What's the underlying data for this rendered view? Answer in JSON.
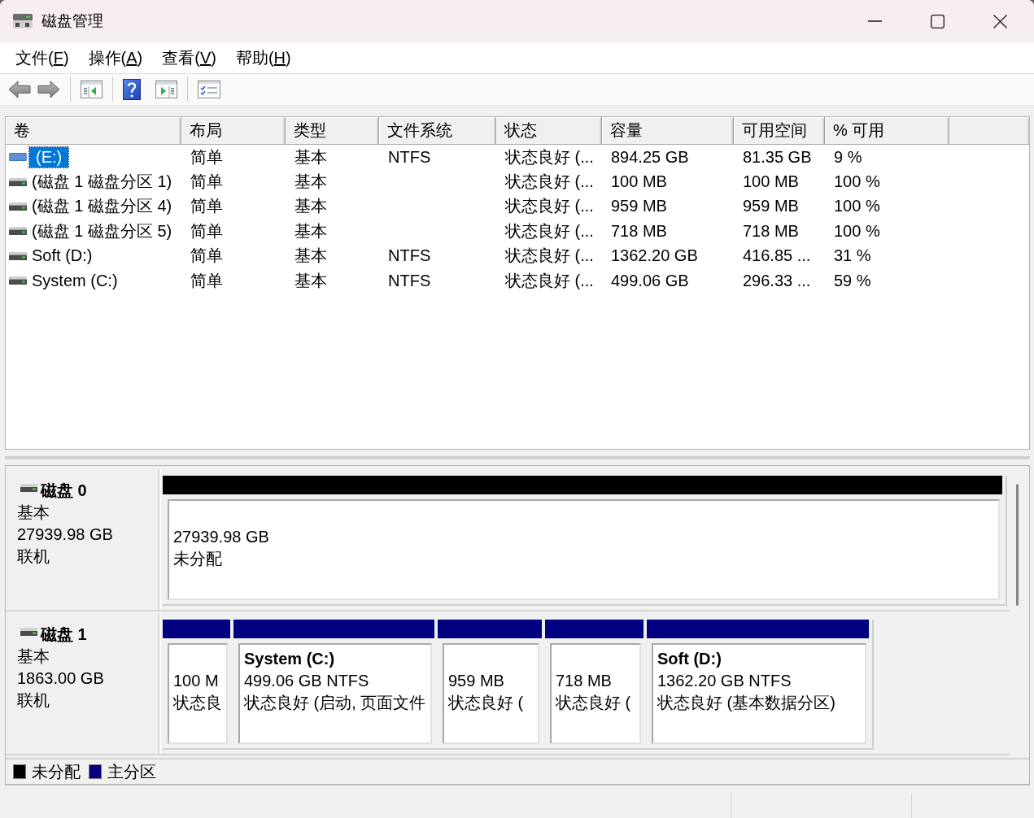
{
  "window": {
    "title": "磁盘管理"
  },
  "menu": [
    {
      "label": "文件(",
      "key": "F",
      "end": ")"
    },
    {
      "label": "操作(",
      "key": "A",
      "end": ")"
    },
    {
      "label": "查看(",
      "key": "V",
      "end": ")"
    },
    {
      "label": "帮助(",
      "key": "H",
      "end": ")"
    }
  ],
  "table": {
    "columns": [
      "卷",
      "布局",
      "类型",
      "文件系统",
      "状态",
      "容量",
      "可用空间",
      "% 可用"
    ],
    "rows": [
      {
        "volume": "(E:)",
        "layout": "简单",
        "type": "基本",
        "file_system": "NTFS",
        "status": "状态良好 (...",
        "capacity": "894.25 GB",
        "free_space": "81.35 GB",
        "percent_free": "9 %",
        "selected": true
      },
      {
        "volume": "(磁盘 1 磁盘分区 1)",
        "layout": "简单",
        "type": "基本",
        "status": "状态良好 (...",
        "capacity": "100 MB",
        "free_space": "100 MB",
        "percent_free": "100 %",
        "selected": false
      },
      {
        "volume": "(磁盘 1 磁盘分区 4)",
        "layout": "简单",
        "type": "基本",
        "status": "状态良好 (...",
        "capacity": "959 MB",
        "free_space": "959 MB",
        "percent_free": "100 %",
        "selected": false
      },
      {
        "volume": "(磁盘 1 磁盘分区 5)",
        "layout": "简单",
        "type": "基本",
        "status": "状态良好 (...",
        "capacity": "718 MB",
        "free_space": "718 MB",
        "percent_free": "100 %",
        "selected": false
      },
      {
        "volume": "Soft (D:)",
        "layout": "简单",
        "type": "基本",
        "file_system": "NTFS",
        "status": "状态良好 (...",
        "capacity": "1362.20 GB",
        "free_space": "416.85 ...",
        "percent_free": "31 %",
        "selected": false
      },
      {
        "volume": "System (C:)",
        "layout": "简单",
        "type": "基本",
        "file_system": "NTFS",
        "status": "状态良好 (...",
        "capacity": "499.06 GB",
        "free_space": "296.33 ...",
        "percent_free": "59 %",
        "selected": false
      }
    ]
  },
  "disks": [
    {
      "name": "磁盘 0",
      "type": "基本",
      "size": "27939.98 GB",
      "status": "联机",
      "partitions": [
        {
          "color": "#000000",
          "lines": [
            "27939.98 GB",
            "未分配"
          ]
        }
      ]
    },
    {
      "name": "磁盘 1",
      "type": "基本",
      "size": "1863.00 GB",
      "status": "联机",
      "partitions": [
        {
          "color": "#000080",
          "lines": [
            "100 M",
            "状态良"
          ]
        },
        {
          "color": "#000080",
          "title": "System (C:)",
          "lines": [
            "499.06 GB NTFS",
            "状态良好 (启动, 页面文件"
          ]
        },
        {
          "color": "#000080",
          "lines": [
            "959 MB",
            "状态良好 ("
          ]
        },
        {
          "color": "#000080",
          "lines": [
            "718 MB",
            "状态良好 ("
          ]
        },
        {
          "color": "#000080",
          "title": "Soft (D:)",
          "lines": [
            "1362.20 GB NTFS",
            "状态良好 (基本数据分区)"
          ]
        }
      ]
    }
  ],
  "legend": [
    {
      "label": "未分配",
      "color": "#000000"
    },
    {
      "label": "主分区",
      "color": "#000080"
    }
  ]
}
